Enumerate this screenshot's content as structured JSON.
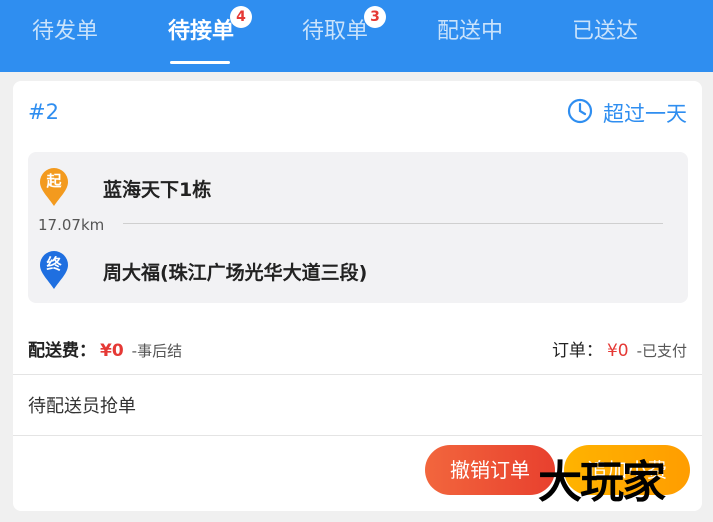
{
  "tabs": [
    {
      "label": "待发单",
      "badge": null,
      "active": false
    },
    {
      "label": "待接单",
      "badge": "4",
      "active": true
    },
    {
      "label": "待取单",
      "badge": "3",
      "active": false
    },
    {
      "label": "配送中",
      "badge": null,
      "active": false
    },
    {
      "label": "已送达",
      "badge": null,
      "active": false
    }
  ],
  "order": {
    "number": "#2",
    "time_label": "超过一天",
    "start_marker": "起",
    "end_marker": "终",
    "start_address": "蓝海天下1栋",
    "end_address": "周大福(珠江广场光华大道三段)",
    "distance": "17.07km",
    "fee_label": "配送费：",
    "fee_value": "¥0",
    "fee_note": "-事后结",
    "order_label": "订单：",
    "order_value": "¥0",
    "order_note": "-已支付",
    "status": "待配送员抢单"
  },
  "buttons": {
    "cancel": "撤销订单",
    "accept": "追加小费"
  },
  "watermark": "大玩家",
  "colors": {
    "primary": "#2f8ef0",
    "price": "#e53935",
    "start_pin": "#f39a1e",
    "end_pin": "#1f6fe0"
  }
}
